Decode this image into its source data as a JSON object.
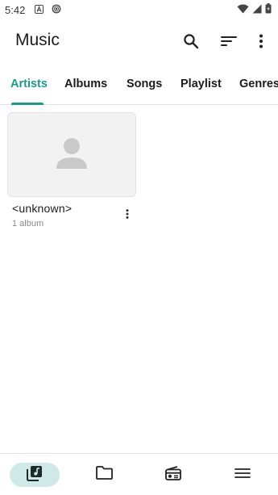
{
  "status_bar": {
    "time": "5:42",
    "notification_icons": [
      "text-a-icon",
      "fingerprint-icon"
    ],
    "system_icons": [
      "wifi-icon",
      "signal-icon",
      "battery-icon"
    ]
  },
  "app_bar": {
    "title": "Music",
    "actions": [
      "search-icon",
      "sort-icon",
      "more-vert-icon"
    ]
  },
  "tabs": [
    {
      "label": "Artists",
      "active": true
    },
    {
      "label": "Albums",
      "active": false
    },
    {
      "label": "Songs",
      "active": false
    },
    {
      "label": "Playlist",
      "active": false
    },
    {
      "label": "Genres",
      "active": false
    }
  ],
  "artists": [
    {
      "name": "<unknown>",
      "subtitle": "1 album",
      "thumbnail_icon": "person-placeholder-icon"
    }
  ],
  "bottom_nav": [
    {
      "icon": "music-library-icon",
      "active": true
    },
    {
      "icon": "folder-icon",
      "active": false
    },
    {
      "icon": "radio-icon",
      "active": false
    },
    {
      "icon": "menu-icon",
      "active": false
    }
  ],
  "colors": {
    "accent": "#1a9a8c",
    "accent_container": "#cfeae6",
    "placeholder_bg": "#f2f2f2",
    "placeholder_icon": "#c9c9c9"
  }
}
